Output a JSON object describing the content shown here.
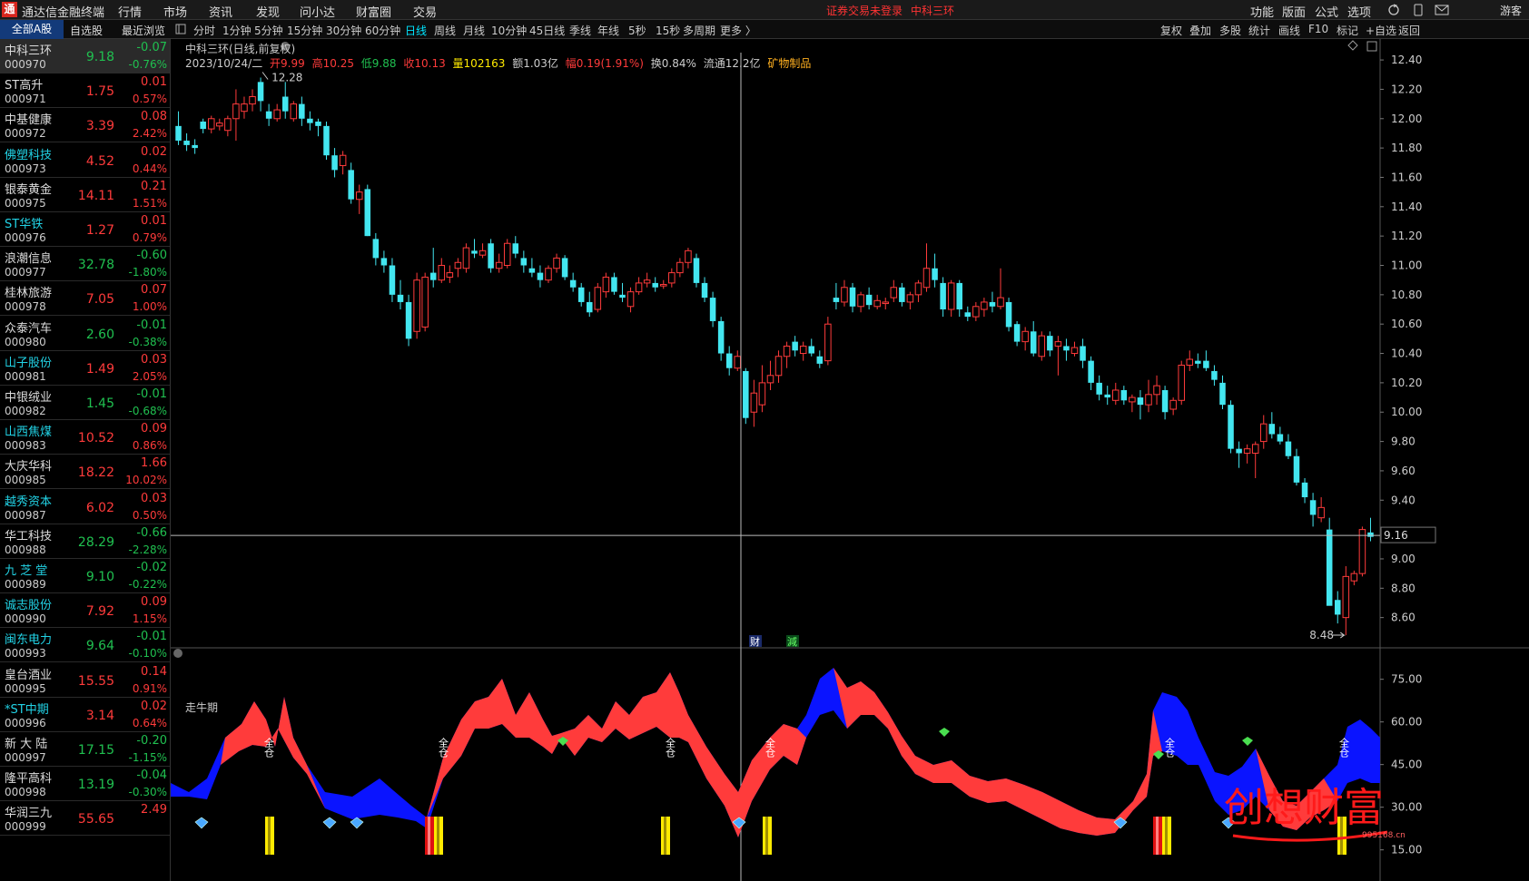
{
  "app": {
    "logo": "通",
    "title": "通达信金融终端",
    "menus": [
      "行情",
      "市场",
      "资讯",
      "发现",
      "问小达",
      "财富圈",
      "交易"
    ],
    "notice": "证券交易未登录",
    "notice_name": "中科三环",
    "right_menus": [
      "功能",
      "版面",
      "公式",
      "选项"
    ],
    "user": "游客"
  },
  "toolbar": {
    "tabs": [
      "全部A股",
      "自选股",
      "最近浏览"
    ],
    "periods": [
      "分时",
      "1分钟",
      "5分钟",
      "15分钟",
      "30分钟",
      "60分钟",
      "日线",
      "周线",
      "月线",
      "10分钟",
      "45日线",
      "季线",
      "年线",
      "5秒",
      "15秒",
      "多周期",
      "更多 〉"
    ],
    "active_period": "日线",
    "right": [
      "复权",
      "叠加",
      "多股",
      "统计",
      "画线",
      "F10",
      "标记",
      "+自选",
      "返回"
    ]
  },
  "stocks": [
    {
      "name": "中科三环",
      "code": "000970",
      "price": "9.18",
      "chg": "-0.07",
      "pct": "-0.76%",
      "dir": "dn",
      "cyan": false
    },
    {
      "name": "ST高升",
      "code": "000971",
      "price": "1.75",
      "chg": "0.01",
      "pct": "0.57%",
      "dir": "up",
      "cyan": false
    },
    {
      "name": "中基健康",
      "code": "000972",
      "price": "3.39",
      "chg": "0.08",
      "pct": "2.42%",
      "dir": "up",
      "cyan": false
    },
    {
      "name": "佛塑科技",
      "code": "000973",
      "price": "4.52",
      "chg": "0.02",
      "pct": "0.44%",
      "dir": "up",
      "cyan": true
    },
    {
      "name": "银泰黄金",
      "code": "000975",
      "price": "14.11",
      "chg": "0.21",
      "pct": "1.51%",
      "dir": "up",
      "cyan": false
    },
    {
      "name": "ST华铁",
      "code": "000976",
      "price": "1.27",
      "chg": "0.01",
      "pct": "0.79%",
      "dir": "up",
      "cyan": true
    },
    {
      "name": "浪潮信息",
      "code": "000977",
      "price": "32.78",
      "chg": "-0.60",
      "pct": "-1.80%",
      "dir": "dn",
      "cyan": false
    },
    {
      "name": "桂林旅游",
      "code": "000978",
      "price": "7.05",
      "chg": "0.07",
      "pct": "1.00%",
      "dir": "up",
      "cyan": false
    },
    {
      "name": "众泰汽车",
      "code": "000980",
      "price": "2.60",
      "chg": "-0.01",
      "pct": "-0.38%",
      "dir": "dn",
      "cyan": false
    },
    {
      "name": "山子股份",
      "code": "000981",
      "price": "1.49",
      "chg": "0.03",
      "pct": "2.05%",
      "dir": "up",
      "cyan": true
    },
    {
      "name": "中银绒业",
      "code": "000982",
      "price": "1.45",
      "chg": "-0.01",
      "pct": "-0.68%",
      "dir": "dn",
      "cyan": false
    },
    {
      "name": "山西焦煤",
      "code": "000983",
      "price": "10.52",
      "chg": "0.09",
      "pct": "0.86%",
      "dir": "up",
      "cyan": true
    },
    {
      "name": "大庆华科",
      "code": "000985",
      "price": "18.22",
      "chg": "1.66",
      "pct": "10.02%",
      "dir": "up",
      "cyan": false
    },
    {
      "name": "越秀资本",
      "code": "000987",
      "price": "6.02",
      "chg": "0.03",
      "pct": "0.50%",
      "dir": "up",
      "cyan": true
    },
    {
      "name": "华工科技",
      "code": "000988",
      "price": "28.29",
      "chg": "-0.66",
      "pct": "-2.28%",
      "dir": "dn",
      "cyan": false
    },
    {
      "name": "九 芝 堂",
      "code": "000989",
      "price": "9.10",
      "chg": "-0.02",
      "pct": "-0.22%",
      "dir": "dn",
      "cyan": true
    },
    {
      "name": "诚志股份",
      "code": "000990",
      "price": "7.92",
      "chg": "0.09",
      "pct": "1.15%",
      "dir": "up",
      "cyan": true
    },
    {
      "name": "闽东电力",
      "code": "000993",
      "price": "9.64",
      "chg": "-0.01",
      "pct": "-0.10%",
      "dir": "dn",
      "cyan": true
    },
    {
      "name": "皇台酒业",
      "code": "000995",
      "price": "15.55",
      "chg": "0.14",
      "pct": "0.91%",
      "dir": "up",
      "cyan": false
    },
    {
      "name": "*ST中期",
      "code": "000996",
      "price": "3.14",
      "chg": "0.02",
      "pct": "0.64%",
      "dir": "up",
      "cyan": true
    },
    {
      "name": "新 大 陆",
      "code": "000997",
      "price": "17.15",
      "chg": "-0.20",
      "pct": "-1.15%",
      "dir": "dn",
      "cyan": false
    },
    {
      "name": "隆平高科",
      "code": "000998",
      "price": "13.19",
      "chg": "-0.04",
      "pct": "-0.30%",
      "dir": "dn",
      "cyan": false
    },
    {
      "name": "华润三九",
      "code": "000999",
      "price": "55.65",
      "chg": "2.49",
      "pct": "",
      "dir": "up",
      "cyan": false
    }
  ],
  "header": {
    "title": "中科三环(日线,前复权)",
    "date": "2023/10/24/二",
    "open": "开9.99",
    "high": "高10.25",
    "low": "低9.88",
    "close": "收10.13",
    "volume": "量102163",
    "amount": "额1.03亿",
    "amp": "幅0.19(1.91%)",
    "turnover": "换0.84%",
    "float": "流通12.2亿",
    "sector": "矿物制品"
  },
  "indicator": {
    "title": "走牛期",
    "label": "全仓",
    "ticks": [
      "75.00",
      "60.00",
      "45.00",
      "30.00",
      "15.00"
    ]
  },
  "badges": {
    "cai": "财",
    "jian": "減"
  },
  "watermark": {
    "text": "创想财富",
    "url": "995168.cn"
  },
  "colors": {
    "up": "#ff3b3b",
    "down": "#43e6f0",
    "bg": "#000000",
    "blue": "#0a14ff",
    "yellow": "#ffea00"
  },
  "chart_data": {
    "type": "candlestick",
    "title": "中科三环(日线,前复权)",
    "ylim": [
      8.4,
      12.45
    ],
    "yticks": [
      "12.40",
      "12.20",
      "12.00",
      "11.80",
      "11.60",
      "11.40",
      "11.20",
      "11.00",
      "10.80",
      "10.60",
      "10.40",
      "10.20",
      "10.00",
      "9.80",
      "9.60",
      "9.40",
      "9.16",
      "9.00",
      "8.80",
      "8.60"
    ],
    "annotations": {
      "max": "12.28",
      "min": "8.48",
      "cursor_price": "9.16"
    },
    "candles": [
      [
        11.95,
        12.05,
        11.82,
        11.85
      ],
      [
        11.85,
        11.9,
        11.78,
        11.82
      ],
      [
        11.82,
        11.86,
        11.76,
        11.8
      ],
      [
        11.98,
        12.0,
        11.9,
        11.93
      ],
      [
        11.93,
        12.02,
        11.9,
        12.0
      ],
      [
        11.95,
        12.0,
        11.92,
        11.97
      ],
      [
        11.92,
        12.02,
        11.88,
        12.0
      ],
      [
        12.0,
        12.2,
        11.85,
        12.1
      ],
      [
        12.05,
        12.15,
        12.0,
        12.1
      ],
      [
        12.1,
        12.2,
        12.05,
        12.15
      ],
      [
        12.25,
        12.28,
        12.05,
        12.12
      ],
      [
        12.05,
        12.1,
        11.95,
        12.0
      ],
      [
        12.0,
        12.1,
        11.98,
        12.06
      ],
      [
        12.15,
        12.25,
        12.0,
        12.05
      ],
      [
        12.0,
        12.12,
        11.98,
        12.1
      ],
      [
        12.1,
        12.15,
        11.95,
        12.0
      ],
      [
        12.0,
        12.05,
        11.92,
        11.97
      ],
      [
        11.98,
        12.0,
        11.88,
        11.95
      ],
      [
        11.95,
        11.98,
        11.72,
        11.75
      ],
      [
        11.75,
        11.8,
        11.6,
        11.65
      ],
      [
        11.68,
        11.78,
        11.62,
        11.75
      ],
      [
        11.65,
        11.7,
        11.42,
        11.45
      ],
      [
        11.45,
        11.55,
        11.35,
        11.5
      ],
      [
        11.52,
        11.55,
        11.2,
        11.2
      ],
      [
        11.18,
        11.22,
        11.0,
        11.05
      ],
      [
        11.05,
        11.1,
        10.95,
        11.0
      ],
      [
        11.0,
        11.05,
        10.75,
        10.8
      ],
      [
        10.8,
        10.9,
        10.7,
        10.75
      ],
      [
        10.75,
        10.8,
        10.45,
        10.5
      ],
      [
        10.55,
        10.95,
        10.5,
        10.9
      ],
      [
        10.58,
        10.95,
        10.55,
        10.92
      ],
      [
        10.95,
        11.12,
        10.85,
        10.9
      ],
      [
        10.9,
        11.05,
        10.88,
        11.0
      ],
      [
        10.92,
        11.0,
        10.88,
        10.95
      ],
      [
        10.98,
        11.05,
        10.92,
        11.02
      ],
      [
        10.98,
        11.15,
        10.95,
        11.12
      ],
      [
        11.1,
        11.18,
        11.05,
        11.08
      ],
      [
        11.07,
        11.15,
        11.05,
        11.1
      ],
      [
        11.15,
        11.18,
        10.95,
        10.98
      ],
      [
        10.98,
        11.08,
        10.95,
        11.02
      ],
      [
        11.0,
        11.18,
        10.98,
        11.15
      ],
      [
        11.15,
        11.2,
        11.05,
        11.08
      ],
      [
        11.05,
        11.1,
        10.95,
        11.0
      ],
      [
        10.98,
        11.05,
        10.92,
        10.95
      ],
      [
        10.95,
        11.0,
        10.85,
        10.9
      ],
      [
        10.9,
        11.0,
        10.88,
        10.98
      ],
      [
        10.98,
        11.08,
        10.95,
        11.05
      ],
      [
        11.05,
        11.07,
        10.9,
        10.92
      ],
      [
        10.9,
        10.95,
        10.82,
        10.85
      ],
      [
        10.85,
        10.88,
        10.72,
        10.75
      ],
      [
        10.75,
        10.82,
        10.65,
        10.68
      ],
      [
        10.7,
        10.88,
        10.68,
        10.85
      ],
      [
        10.82,
        10.95,
        10.78,
        10.92
      ],
      [
        10.92,
        10.95,
        10.8,
        10.82
      ],
      [
        10.8,
        10.88,
        10.75,
        10.78
      ],
      [
        10.72,
        10.85,
        10.68,
        10.82
      ],
      [
        10.82,
        10.92,
        10.8,
        10.88
      ],
      [
        10.88,
        10.95,
        10.85,
        10.9
      ],
      [
        10.88,
        10.92,
        10.82,
        10.85
      ],
      [
        10.86,
        10.9,
        10.84,
        10.87
      ],
      [
        10.88,
        10.98,
        10.85,
        10.95
      ],
      [
        10.95,
        11.05,
        10.92,
        11.02
      ],
      [
        11.02,
        11.12,
        10.98,
        11.1
      ],
      [
        11.05,
        11.08,
        10.85,
        10.88
      ],
      [
        10.88,
        10.92,
        10.75,
        10.78
      ],
      [
        10.78,
        10.82,
        10.58,
        10.62
      ],
      [
        10.62,
        10.65,
        10.35,
        10.4
      ],
      [
        10.4,
        10.45,
        10.25,
        10.3
      ],
      [
        10.3,
        10.42,
        10.28,
        10.38
      ],
      [
        10.28,
        10.3,
        9.92,
        9.96
      ],
      [
        10.0,
        10.22,
        9.9,
        10.13
      ],
      [
        10.05,
        10.32,
        10.0,
        10.2
      ],
      [
        10.2,
        10.35,
        10.15,
        10.25
      ],
      [
        10.25,
        10.42,
        10.2,
        10.38
      ],
      [
        10.38,
        10.48,
        10.3,
        10.45
      ],
      [
        10.48,
        10.52,
        10.38,
        10.42
      ],
      [
        10.4,
        10.48,
        10.35,
        10.45
      ],
      [
        10.45,
        10.5,
        10.38,
        10.4
      ],
      [
        10.38,
        10.42,
        10.3,
        10.33
      ],
      [
        10.35,
        10.65,
        10.32,
        10.6
      ],
      [
        10.78,
        10.88,
        10.7,
        10.75
      ],
      [
        10.75,
        10.9,
        10.72,
        10.85
      ],
      [
        10.85,
        10.88,
        10.68,
        10.72
      ],
      [
        10.72,
        10.82,
        10.68,
        10.8
      ],
      [
        10.8,
        10.85,
        10.7,
        10.73
      ],
      [
        10.72,
        10.8,
        10.7,
        10.76
      ],
      [
        10.74,
        10.78,
        10.7,
        10.75
      ],
      [
        10.78,
        10.9,
        10.75,
        10.85
      ],
      [
        10.85,
        10.88,
        10.72,
        10.75
      ],
      [
        10.75,
        10.82,
        10.7,
        10.8
      ],
      [
        10.8,
        10.9,
        10.75,
        10.88
      ],
      [
        10.85,
        11.15,
        10.82,
        10.98
      ],
      [
        10.98,
        11.08,
        10.85,
        10.9
      ],
      [
        10.88,
        10.92,
        10.65,
        10.7
      ],
      [
        10.7,
        10.9,
        10.65,
        10.88
      ],
      [
        10.88,
        10.9,
        10.65,
        10.7
      ],
      [
        10.68,
        10.72,
        10.62,
        10.65
      ],
      [
        10.65,
        10.75,
        10.62,
        10.72
      ],
      [
        10.7,
        10.78,
        10.65,
        10.75
      ],
      [
        10.75,
        10.82,
        10.68,
        10.72
      ],
      [
        10.72,
        10.98,
        10.7,
        10.78
      ],
      [
        10.75,
        10.78,
        10.55,
        10.58
      ],
      [
        10.6,
        10.62,
        10.45,
        10.48
      ],
      [
        10.48,
        10.58,
        10.42,
        10.55
      ],
      [
        10.55,
        10.62,
        10.38,
        10.4
      ],
      [
        10.38,
        10.55,
        10.35,
        10.52
      ],
      [
        10.52,
        10.55,
        10.38,
        10.42
      ],
      [
        10.45,
        10.52,
        10.25,
        10.48
      ],
      [
        10.45,
        10.5,
        10.35,
        10.42
      ],
      [
        10.4,
        10.48,
        10.38,
        10.44
      ],
      [
        10.45,
        10.5,
        10.3,
        10.35
      ],
      [
        10.35,
        10.38,
        10.15,
        10.2
      ],
      [
        10.2,
        10.25,
        10.08,
        10.12
      ],
      [
        10.12,
        10.18,
        10.05,
        10.1
      ],
      [
        10.08,
        10.2,
        10.05,
        10.15
      ],
      [
        10.15,
        10.18,
        10.05,
        10.08
      ],
      [
        10.07,
        10.12,
        10.0,
        10.1
      ],
      [
        10.1,
        10.15,
        9.95,
        10.05
      ],
      [
        10.05,
        10.22,
        10.0,
        10.12
      ],
      [
        10.12,
        10.25,
        10.05,
        10.18
      ],
      [
        10.15,
        10.18,
        9.95,
        10.0
      ],
      [
        10.02,
        10.1,
        9.98,
        10.08
      ],
      [
        10.08,
        10.35,
        10.05,
        10.32
      ],
      [
        10.32,
        10.42,
        10.28,
        10.36
      ],
      [
        10.35,
        10.4,
        10.3,
        10.33
      ],
      [
        10.35,
        10.42,
        10.28,
        10.3
      ],
      [
        10.28,
        10.32,
        10.18,
        10.22
      ],
      [
        10.2,
        10.25,
        10.02,
        10.05
      ],
      [
        10.05,
        10.08,
        9.72,
        9.75
      ],
      [
        9.75,
        9.8,
        9.62,
        9.72
      ],
      [
        9.72,
        9.78,
        9.65,
        9.75
      ],
      [
        9.72,
        9.8,
        9.55,
        9.78
      ],
      [
        9.8,
        9.98,
        9.75,
        9.92
      ],
      [
        9.92,
        10.0,
        9.82,
        9.85
      ],
      [
        9.85,
        9.9,
        9.78,
        9.8
      ],
      [
        9.8,
        9.85,
        9.68,
        9.7
      ],
      [
        9.7,
        9.75,
        9.5,
        9.52
      ],
      [
        9.52,
        9.55,
        9.38,
        9.42
      ],
      [
        9.4,
        9.45,
        9.22,
        9.3
      ],
      [
        9.28,
        9.42,
        9.25,
        9.35
      ],
      [
        9.2,
        9.28,
        8.72,
        8.68
      ],
      [
        8.72,
        8.78,
        8.56,
        8.62
      ],
      [
        8.6,
        8.95,
        8.48,
        8.88
      ],
      [
        8.85,
        8.92,
        8.82,
        8.9
      ],
      [
        8.9,
        9.22,
        8.88,
        9.2
      ],
      [
        9.18,
        9.28,
        9.12,
        9.15
      ]
    ]
  }
}
